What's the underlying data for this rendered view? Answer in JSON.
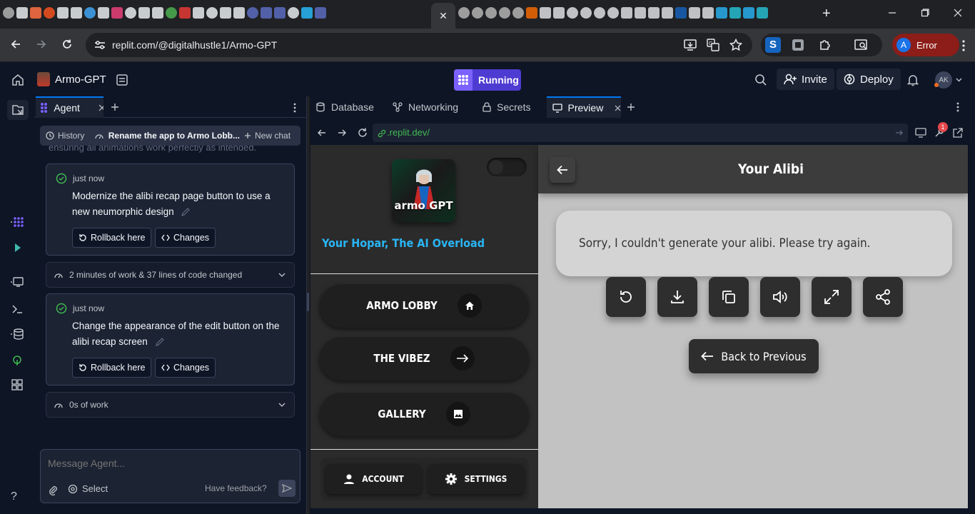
{
  "browser": {
    "active_tab_close": "✕",
    "new_tab": "+",
    "url": "replit.com/@digitalhustle1/Armo-GPT",
    "profile_initial": "A",
    "profile_status": "Error"
  },
  "replit": {
    "project_name": "Armo-GPT",
    "run_status": "Running",
    "invite_label": "Invite",
    "deploy_label": "Deploy",
    "avatar_initials": "AK"
  },
  "agent": {
    "tab_label": "Agent",
    "history_label": "History",
    "chat_title": "Rename the app to Armo Lobb...",
    "new_chat_label": "New chat",
    "truncated_text": "ensuring all animations work perfectly as intended.",
    "checkpoints": [
      {
        "time": "just now",
        "message": "Modernize the alibi recap page button to use a new neumorphic design",
        "rollback_label": "Rollback here",
        "changes_label": "Changes"
      },
      {
        "time": "just now",
        "message": "Change the appearance of the edit button on the alibi recap screen",
        "rollback_label": "Rollback here",
        "changes_label": "Changes"
      }
    ],
    "work_summaries": [
      "2 minutes of work & 37 lines of code changed",
      "0s of work"
    ],
    "message_placeholder": "Message Agent...",
    "select_label": "Select",
    "feedback_label": "Have feedback?"
  },
  "workspace": {
    "tabs": [
      "Database",
      "Networking",
      "Secrets",
      "Preview"
    ],
    "preview_url": ".replit.dev/",
    "notification_count": "1"
  },
  "app": {
    "logo_text": "armo GPT",
    "tagline": "Your Hopar, The AI Overload",
    "nav": [
      {
        "label": "ARMO LOBBY",
        "icon": "home-icon"
      },
      {
        "label": "THE VIBEZ",
        "icon": "arrow-right-icon"
      },
      {
        "label": "GALLERY",
        "icon": "image-icon"
      }
    ],
    "account_label": "ACCOUNT",
    "settings_label": "SETTINGS",
    "page_title": "Your Alibi",
    "error_message": "Sorry, I couldn't generate your alibi. Please try again.",
    "actions": [
      "refresh-icon",
      "download-icon",
      "copy-icon",
      "speaker-icon",
      "expand-icon",
      "share-icon"
    ],
    "back_label": "Back to Previous"
  },
  "colors": {
    "replit_bg": "#0e1525",
    "run_purple": "#4e3bd1",
    "tagline_blue": "#29b6f6",
    "error_pill": "#8c1d18"
  }
}
